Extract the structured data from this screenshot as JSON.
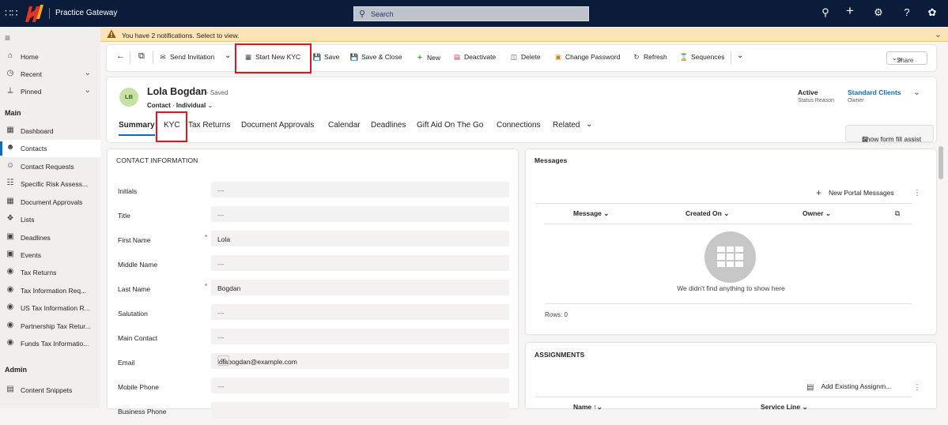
{
  "app": {
    "brand": "Practice Gateway",
    "search_placeholder": "Search"
  },
  "topbar_icons": [
    "lightbulb-icon",
    "plus-icon",
    "gear-icon",
    "help-icon",
    "copilot-icon"
  ],
  "notification": {
    "text": "You have 2 notifications. Select to view."
  },
  "sidebar": {
    "items": [
      {
        "label": "Home",
        "icon": "home-icon"
      },
      {
        "label": "Recent",
        "icon": "clock-icon"
      },
      {
        "label": "Pinned",
        "icon": "pin-icon"
      }
    ],
    "section_main": "Main",
    "main_items": [
      {
        "label": "Dashboard",
        "icon": "dashboard-icon"
      },
      {
        "label": "Contacts",
        "icon": "person-icon"
      },
      {
        "label": "Contact Requests",
        "icon": "person-request-icon"
      },
      {
        "label": "Specific Risk Assess...",
        "icon": "risk-icon"
      },
      {
        "label": "Document Approvals",
        "icon": "document-icon"
      },
      {
        "label": "Lists",
        "icon": "lists-icon"
      },
      {
        "label": "Deadlines",
        "icon": "calendar-icon"
      },
      {
        "label": "Events",
        "icon": "calendar-icon"
      },
      {
        "label": "Tax Returns",
        "icon": "tax-icon"
      },
      {
        "label": "Tax Information Req...",
        "icon": "tax-icon"
      },
      {
        "label": "US Tax Information R...",
        "icon": "tax-icon"
      },
      {
        "label": "Partnership Tax Retur...",
        "icon": "tax-icon"
      },
      {
        "label": "Funds Tax Informatio...",
        "icon": "tax-icon"
      }
    ],
    "section_admin": "Admin",
    "admin_items": [
      {
        "label": "Content Snippets",
        "icon": "snippet-icon"
      }
    ]
  },
  "commands": {
    "send_invitation": "Send Invitation",
    "start_new_kyc": "Start New KYC",
    "save": "Save",
    "save_close": "Save & Close",
    "new": "New",
    "deactivate": "Deactivate",
    "delete": "Delete",
    "change_password": "Change Password",
    "refresh": "Refresh",
    "sequences": "Sequences",
    "share": "Share"
  },
  "record": {
    "initials": "LB",
    "name": "Lola Bogdan",
    "saved": "- Saved",
    "entity": "Contact",
    "form": "Individual",
    "status_value": "Active",
    "status_label": "Status Reason",
    "owner_value": "Standard Clients",
    "owner_label": "Owner"
  },
  "tabs": [
    "Summary",
    "KYC",
    "Tax Returns",
    "Document Approvals",
    "Calendar",
    "Deadlines",
    "Gift Aid On The Go",
    "Connections",
    "Related"
  ],
  "show_form_fill_assist": "Show form fill assist",
  "contact_info": {
    "title": "CONTACT INFORMATION",
    "fields": [
      {
        "label": "Initials",
        "value": "---",
        "required": false
      },
      {
        "label": "Title",
        "value": "---",
        "required": false
      },
      {
        "label": "First Name",
        "value": "Lola",
        "required": true
      },
      {
        "label": "Middle Name",
        "value": "---",
        "required": false
      },
      {
        "label": "Last Name",
        "value": "Bogdan",
        "required": true
      },
      {
        "label": "Salutation",
        "value": "---",
        "required": false
      },
      {
        "label": "Main Contact",
        "value": "---",
        "required": false
      },
      {
        "label": "Email",
        "value": "lolabogdan@example.com",
        "required": false
      },
      {
        "label": "Mobile Phone",
        "value": "---",
        "required": false
      },
      {
        "label": "Business Phone",
        "value": "",
        "required": false
      }
    ]
  },
  "messages": {
    "title": "Messages",
    "new_label": "New Portal Messages",
    "columns": [
      "Message",
      "Created On",
      "Owner"
    ],
    "empty_text": "We didn't find anything to show here",
    "rows_text": "Rows: 0"
  },
  "assignments": {
    "title": "ASSIGNMENTS",
    "add_label": "Add Existing Assignm...",
    "columns": [
      "Name",
      "Service Line"
    ]
  }
}
